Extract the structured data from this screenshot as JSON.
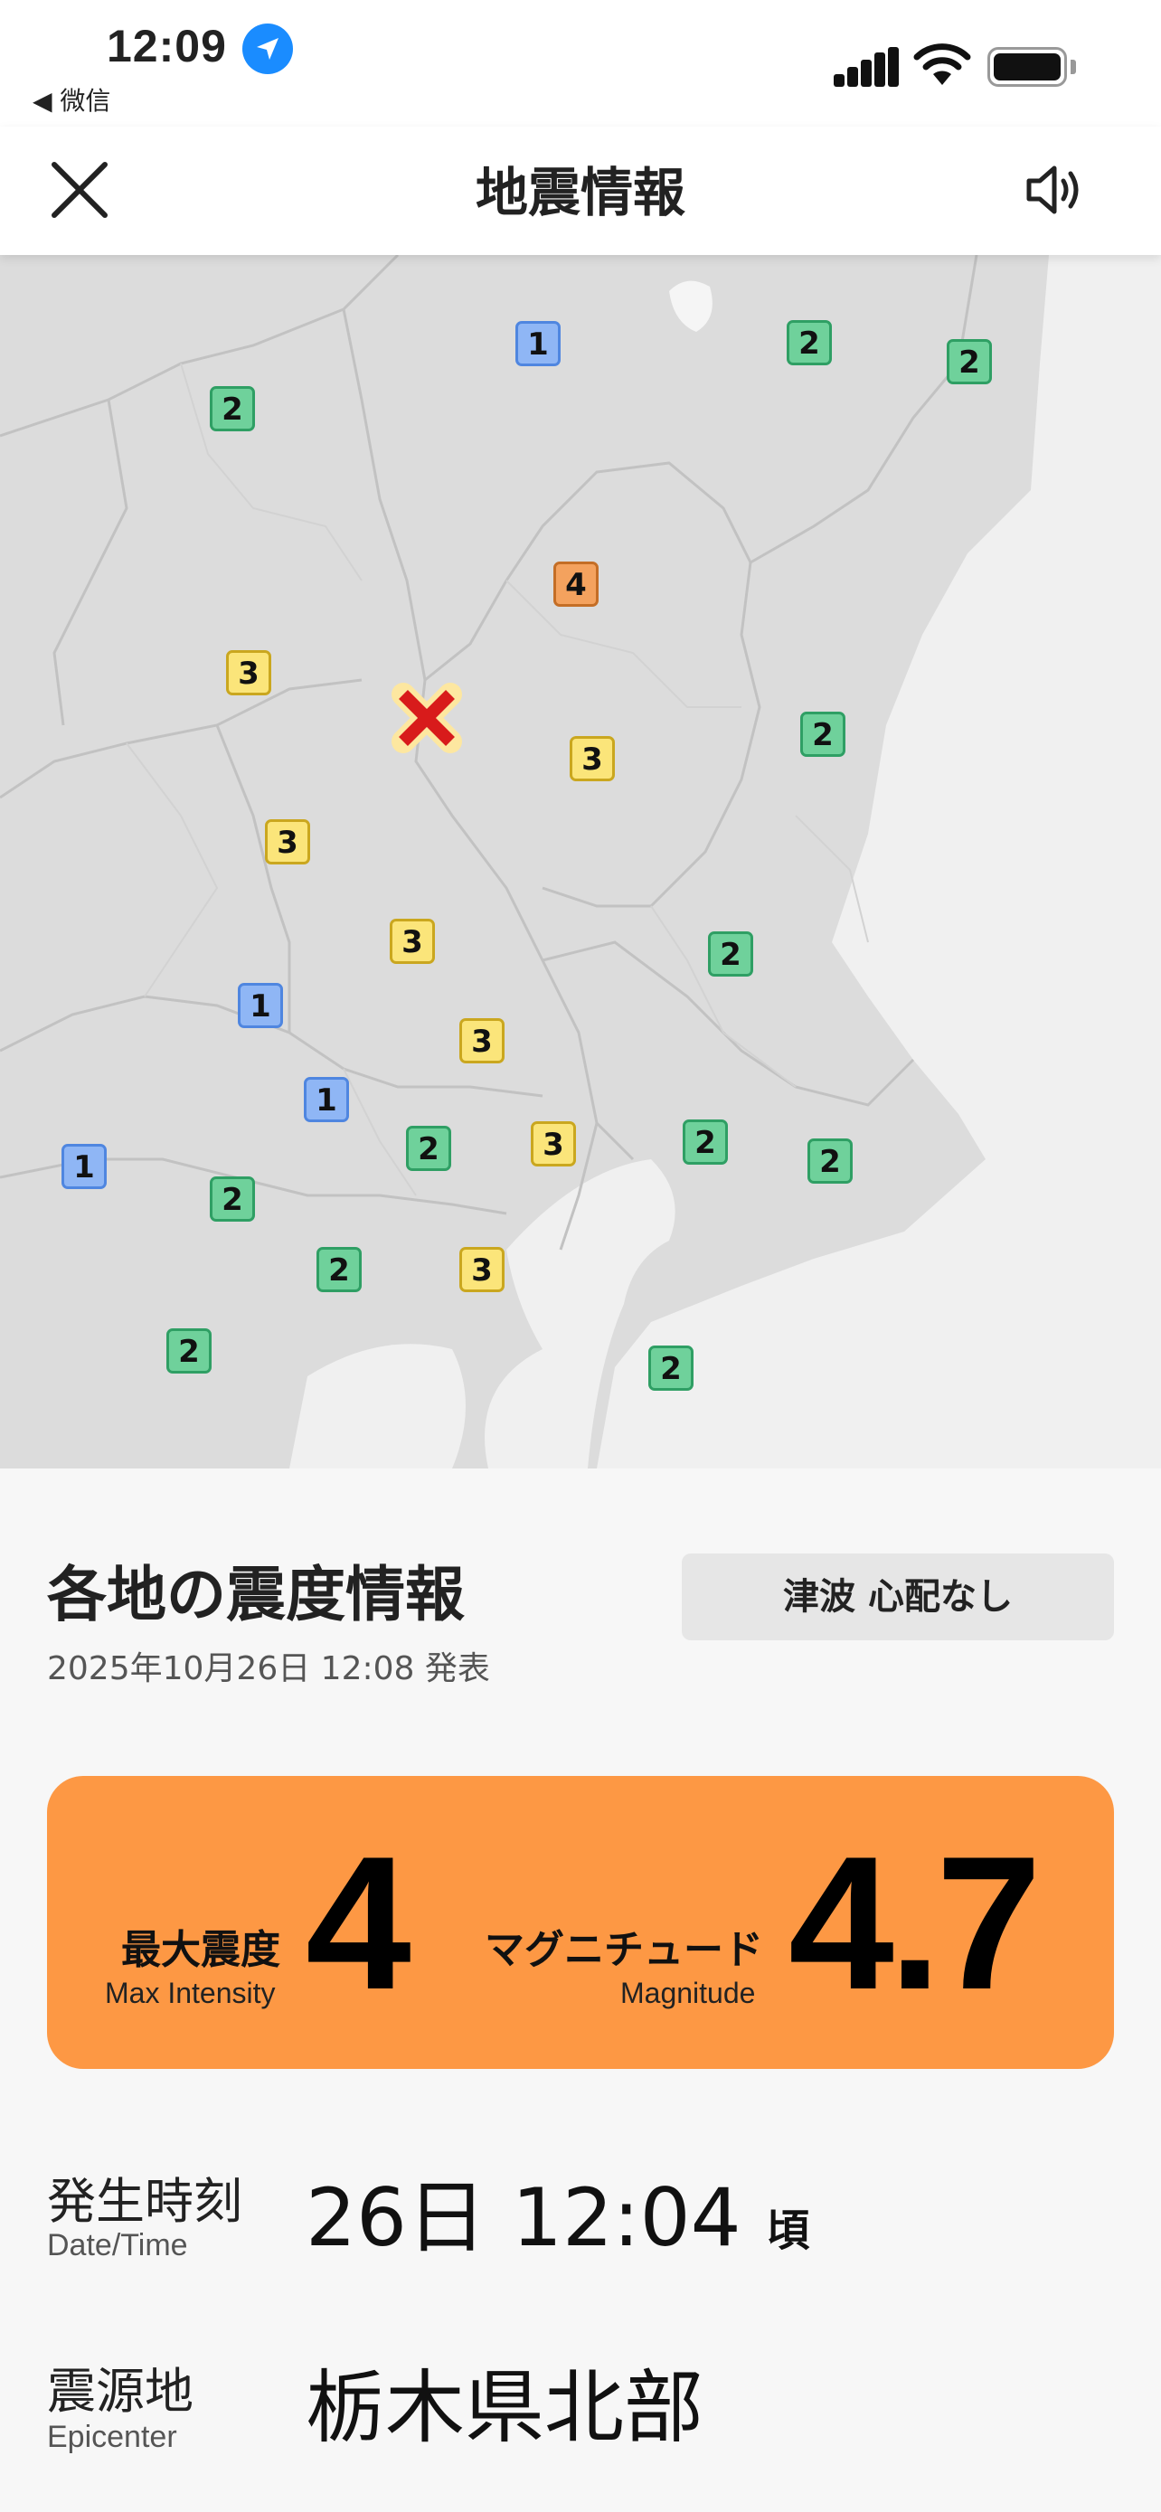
{
  "status_bar": {
    "time": "12:09",
    "back_app": "◀ 微信"
  },
  "nav": {
    "title": "地震情報",
    "close_icon": "close-icon",
    "sound_icon": "speaker-icon"
  },
  "map": {
    "markers": [
      "1",
      "2",
      "2",
      "2",
      "4",
      "3",
      "3",
      "2",
      "3",
      "3",
      "2",
      "1",
      "3",
      "1",
      "1",
      "2",
      "3",
      "2",
      "2",
      "2",
      "2",
      "3",
      "2",
      "2"
    ]
  },
  "info": {
    "section_title": "各地の震度情報",
    "issued": "2025年10月26日 12:08 発表",
    "tsunami": "津波 心配なし",
    "summary_color": "#fd9844",
    "max_intensity_ja": "最大震度",
    "max_intensity_en": "Max Intensity",
    "max_intensity_value": "4",
    "magnitude_ja": "マグニチュード",
    "magnitude_en": "Magnitude",
    "magnitude_value": "4.7",
    "datetime_ja": "発生時刻",
    "datetime_en": "Date/Time",
    "datetime_value": "26日 12:04",
    "datetime_suffix": "頃",
    "epicenter_ja": "震源地",
    "epicenter_en": "Epicenter",
    "epicenter_value": "栃木県北部"
  }
}
